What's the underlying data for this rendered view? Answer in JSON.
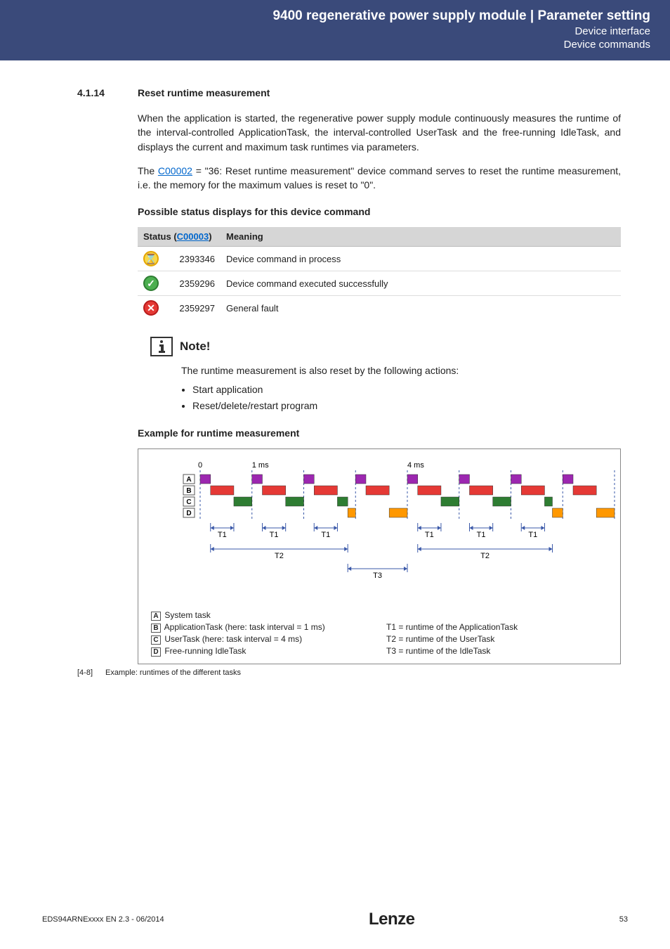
{
  "header": {
    "title": "9400 regenerative power supply module | Parameter setting",
    "sub1": "Device interface",
    "sub2": "Device commands"
  },
  "section": {
    "num": "4.1.14",
    "title": "Reset runtime measurement"
  },
  "para1": "When the application is started, the regenerative power supply module continuously measures the runtime of the interval-controlled ApplicationTask, the interval-controlled UserTask and the free-running IdleTask, and displays the current and maximum task runtimes via parameters.",
  "para2_pre": "The ",
  "para2_link": "C00002",
  "para2_post": " = \"36: Reset runtime measurement\" device command serves to reset the runtime measurement, i.e. the memory for the maximum values is reset to \"0\".",
  "subhead1": "Possible status displays for this device command",
  "status_table": {
    "col1_pre": "Status (",
    "col1_link": "C00003",
    "col1_post": ")",
    "col2": "Meaning",
    "rows": [
      {
        "icon": "hourglass",
        "glyph": "⌛",
        "code": "2393346",
        "meaning": "Device command in process"
      },
      {
        "icon": "check",
        "glyph": "✓",
        "code": "2359296",
        "meaning": "Device command executed successfully"
      },
      {
        "icon": "error",
        "glyph": "✕",
        "code": "2359297",
        "meaning": "General fault"
      }
    ]
  },
  "note": {
    "label": "Note!",
    "text": "The runtime measurement is also reset by the following actions:",
    "items": [
      "Start application",
      "Reset/delete/restart program"
    ]
  },
  "subhead2": "Example for runtime measurement",
  "chart_data": {
    "type": "gantt",
    "timeline": {
      "start": 0,
      "ticks_ms": [
        0,
        1,
        4
      ],
      "axis_labels": [
        "0",
        "1 ms",
        "4 ms"
      ]
    },
    "rows": [
      {
        "id": "A",
        "label": "System task",
        "segments": [
          [
            0.0,
            0.2
          ],
          [
            1.0,
            1.2
          ],
          [
            2.0,
            2.2
          ],
          [
            3.0,
            3.2
          ],
          [
            4.0,
            4.2
          ],
          [
            5.0,
            5.2
          ],
          [
            6.0,
            6.2
          ],
          [
            7.0,
            7.2
          ]
        ],
        "color": "#9c27b0"
      },
      {
        "id": "B",
        "label": "ApplicationTask (here: task interval = 1 ms)",
        "segments": [
          [
            0.2,
            0.65
          ],
          [
            1.2,
            1.65
          ],
          [
            2.2,
            2.65
          ],
          [
            3.2,
            3.65
          ],
          [
            4.2,
            4.65
          ],
          [
            5.2,
            5.65
          ],
          [
            6.2,
            6.65
          ],
          [
            7.2,
            7.65
          ]
        ],
        "color": "#e53935"
      },
      {
        "id": "C",
        "label": "UserTask (here: task interval = 4 ms)",
        "segments": [
          [
            0.65,
            1.0
          ],
          [
            1.65,
            2.0
          ],
          [
            2.65,
            2.85
          ],
          [
            4.65,
            5.0
          ],
          [
            5.65,
            6.0
          ],
          [
            6.65,
            6.8
          ]
        ],
        "color": "#2e7d32"
      },
      {
        "id": "D",
        "label": "Free-running IdleTask",
        "segments": [
          [
            2.85,
            3.0
          ],
          [
            3.65,
            4.0
          ],
          [
            6.8,
            7.0
          ],
          [
            7.65,
            8.0
          ]
        ],
        "color": "#ff9800"
      }
    ],
    "annotations": {
      "T1": "runtime of the ApplicationTask",
      "T2": "runtime of the UserTask",
      "T3": "runtime of the IdleTask",
      "T1_spans": [
        [
          0.2,
          0.65
        ],
        [
          1.2,
          1.65
        ],
        [
          2.2,
          2.65
        ],
        [
          4.2,
          4.65
        ],
        [
          5.2,
          5.65
        ],
        [
          6.2,
          6.65
        ]
      ],
      "T2_spans": [
        [
          0.2,
          2.85
        ],
        [
          4.2,
          6.8
        ]
      ],
      "T3_spans": [
        [
          2.85,
          4.0
        ]
      ]
    }
  },
  "legend": {
    "left": [
      {
        "box": "A",
        "text": "System task"
      },
      {
        "box": "B",
        "text": "ApplicationTask (here: task interval = 1 ms)"
      },
      {
        "box": "C",
        "text": "UserTask (here: task interval = 4 ms)"
      },
      {
        "box": "D",
        "text": "Free-running IdleTask"
      }
    ],
    "right": [
      "",
      "T1 = runtime of the ApplicationTask",
      "T2 = runtime of the UserTask",
      "T3 = runtime of the IdleTask"
    ]
  },
  "fig": {
    "num": "[4-8]",
    "text": "Example: runtimes of the different tasks"
  },
  "footer": {
    "left": "EDS94ARNExxxx EN 2.3 - 06/2014",
    "logo": "Lenze",
    "page": "53"
  }
}
